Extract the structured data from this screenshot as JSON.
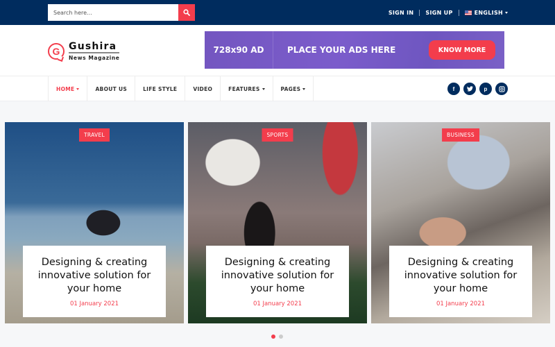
{
  "topbar": {
    "search": {
      "placeholder": "Search here...",
      "value": ""
    },
    "search_icon": "search-icon",
    "links": [
      {
        "label": "SIGN IN"
      },
      {
        "label": "SIGN UP"
      }
    ],
    "language": {
      "label": "ENGLISH",
      "flag": "us-flag-icon"
    }
  },
  "header": {
    "logo": {
      "letter": "G",
      "name": "Gushira",
      "tagline": "News Magazine"
    },
    "ad": {
      "size_label": "728x90 AD",
      "message": "PLACE YOUR ADS HERE",
      "button_label": "KNOW MORE"
    }
  },
  "nav": {
    "items": [
      {
        "label": "HOME",
        "dropdown": true,
        "active": true
      },
      {
        "label": "ABOUT US",
        "dropdown": false
      },
      {
        "label": "LIFE STYLE",
        "dropdown": false
      },
      {
        "label": "VIDEO",
        "dropdown": false
      },
      {
        "label": "FEATURES",
        "dropdown": true
      },
      {
        "label": "PAGES",
        "dropdown": true
      }
    ],
    "social": [
      {
        "icon": "facebook-icon",
        "glyph": "f"
      },
      {
        "icon": "twitter-icon",
        "glyph": "t"
      },
      {
        "icon": "pinterest-icon",
        "glyph": "p"
      },
      {
        "icon": "instagram-icon",
        "glyph": "◎"
      }
    ]
  },
  "slider": {
    "cards": [
      {
        "category": "TRAVEL",
        "title": "Designing & creating innovative solution for your home",
        "date": "01 January 2021"
      },
      {
        "category": "SPORTS",
        "title": "Designing & creating innovative solution for your home",
        "date": "01 January 2021"
      },
      {
        "category": "BUSINESS",
        "title": "Designing & creating innovative solution for your home",
        "date": "01 January 2021"
      }
    ],
    "pages": 2,
    "active_page": 1
  },
  "colors": {
    "primary_navy": "#002c5e",
    "accent_red": "#f33d4c",
    "ad_purple": "#7356c0",
    "page_bg": "#f6f7f9"
  }
}
